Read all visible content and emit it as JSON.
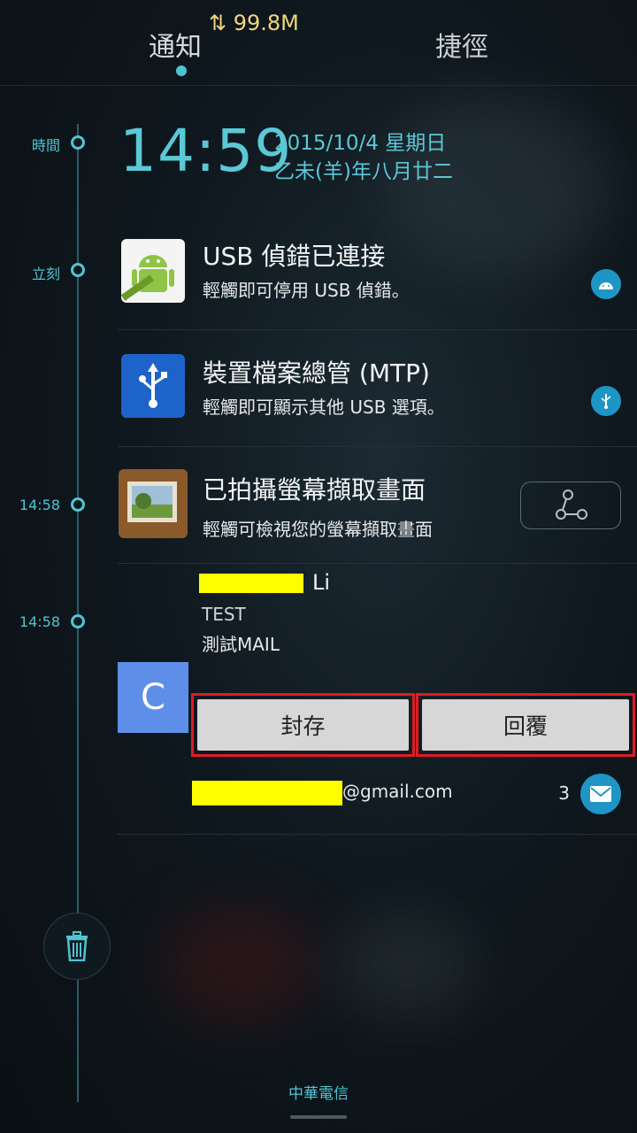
{
  "header": {
    "tabs": [
      {
        "label": "通知"
      },
      {
        "label": "捷徑"
      }
    ],
    "data_usage": "⇅ 99.8M"
  },
  "timeline": {
    "labels": [
      "時間",
      "立刻",
      "14:58",
      "14:58"
    ]
  },
  "clock": {
    "time": "14:59",
    "date": "2015/10/4  星期日",
    "lunar": "乙未(羊)年八月廿二"
  },
  "notifications": [
    {
      "title": "USB 偵錯已連接",
      "text": "輕觸即可停用 USB 偵錯。",
      "icon": "android-icon"
    },
    {
      "title": "裝置檔案總管 (MTP)",
      "text": "輕觸即可顯示其他 USB 選項。",
      "icon": "usb-icon"
    },
    {
      "title": "已拍攝螢幕擷取畫面",
      "text": "輕觸可檢視您的螢幕擷取畫面",
      "icon": "gallery-icon"
    }
  ],
  "mail": {
    "sender_suffix": "Li",
    "subject": "TEST",
    "body": "測試MAIL",
    "avatar_letter": "C",
    "archive_label": "封存",
    "reply_label": "回覆",
    "account_suffix": "@gmail.com",
    "count": "3",
    "icon": "mail-icon"
  },
  "footer": {
    "carrier": "中華電信"
  },
  "colors": {
    "accent": "#50c4d2",
    "highlight_yellow": "#ffff00",
    "red_outline": "#e01b23"
  }
}
